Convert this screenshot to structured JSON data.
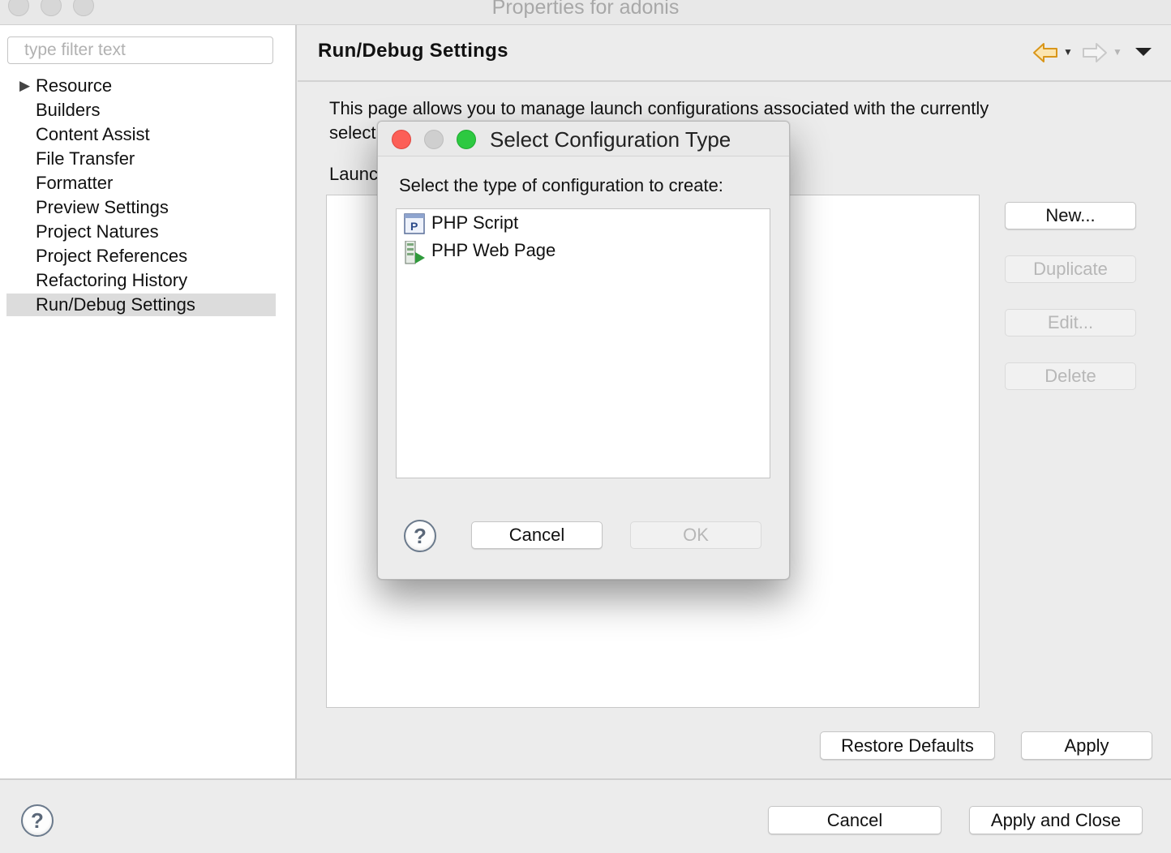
{
  "window": {
    "title": "Properties for adonis"
  },
  "sidebar": {
    "filter_placeholder": "type filter text",
    "items": [
      {
        "label": "Resource"
      },
      {
        "label": "Builders"
      },
      {
        "label": "Content Assist"
      },
      {
        "label": "File Transfer"
      },
      {
        "label": "Formatter"
      },
      {
        "label": "Preview Settings"
      },
      {
        "label": "Project Natures"
      },
      {
        "label": "Project References"
      },
      {
        "label": "Refactoring History"
      },
      {
        "label": "Run/Debug Settings"
      }
    ],
    "selected_item": "Run/Debug Settings"
  },
  "page": {
    "title": "Run/Debug Settings",
    "description_line1": "This page allows you to manage launch configurations associated with the currently",
    "description_line2_visible": "select",
    "launch_label_visible": "Launc",
    "buttons": {
      "new": "New...",
      "duplicate": "Duplicate",
      "edit": "Edit...",
      "delete": "Delete"
    },
    "restore_defaults": "Restore Defaults",
    "apply": "Apply"
  },
  "footer": {
    "cancel": "Cancel",
    "apply_and_close": "Apply and Close"
  },
  "dialog": {
    "title": "Select Configuration Type",
    "prompt": "Select the type of configuration to create:",
    "types": [
      {
        "label": "PHP Script",
        "icon": "php-script-icon"
      },
      {
        "label": "PHP Web Page",
        "icon": "php-web-page-icon"
      }
    ],
    "cancel": "Cancel",
    "ok": "OK"
  },
  "colors": {
    "window_bg": "#ececec",
    "list_bg": "#ffffff",
    "selected_row": "#dcdcdc",
    "close_dot": "#fc5f57",
    "minimize_dot": "#cfcfcf",
    "zoom_dot": "#2dc941",
    "back_arrow": "#e4a21a"
  }
}
